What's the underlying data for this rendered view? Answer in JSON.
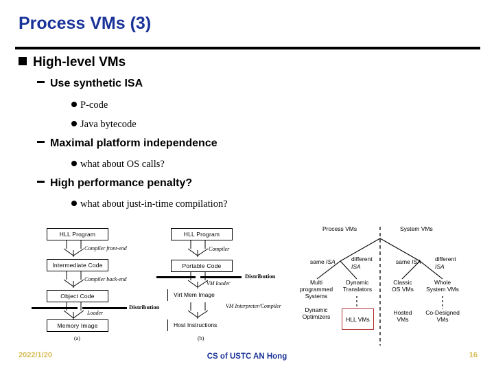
{
  "slide": {
    "title": "Process VMs (3)",
    "title_color": "#1a3399",
    "accent_rule_color": "#000000"
  },
  "outline": [
    {
      "level": 1,
      "text": "High-level VMs"
    },
    {
      "level": 2,
      "text": "Use synthetic ISA"
    },
    {
      "level": 3,
      "text": "P-code"
    },
    {
      "level": 3,
      "text": "Java bytecode"
    },
    {
      "level": 2,
      "text": "Maximal platform independence"
    },
    {
      "level": 3,
      "text": "what about OS calls?"
    },
    {
      "level": 2,
      "text": "High performance penalty?"
    },
    {
      "level": 3,
      "text": "what about just-in-time compilation?"
    }
  ],
  "diagram_a": {
    "caption": "(a)",
    "boxes": [
      "HLL Program",
      "Intermediate Code",
      "Object Code",
      "Memory Image"
    ],
    "edge_labels": [
      "Compiler front-end",
      "Compiler back-end",
      "Loader"
    ],
    "distribution_label": "Distribution"
  },
  "diagram_b": {
    "caption": "(b)",
    "boxes": [
      "HLL Program",
      "Portable Code"
    ],
    "bars": [
      "Virt Mem Image",
      "Host Instructions"
    ],
    "edge_labels": [
      "Compiler",
      "VM loader",
      "VM Interpreter/Compiler"
    ],
    "distribution_label": "Distribution"
  },
  "taxonomy": {
    "headings": [
      "Process VMs",
      "System VMs"
    ],
    "edge_labels": [
      {
        "plain": "same ",
        "italic": "ISA"
      },
      {
        "plain": "different ",
        "italic": "ISA"
      },
      {
        "plain": "same ",
        "italic": "ISA"
      },
      {
        "plain": "different ",
        "italic": "ISA"
      }
    ],
    "nodes": [
      {
        "lines": [
          "Multi",
          "programmed",
          "Systems"
        ]
      },
      {
        "lines": [
          "Dynamic",
          "Translators"
        ]
      },
      {
        "lines": [
          "Classic",
          "OS VMs"
        ]
      },
      {
        "lines": [
          "Whole",
          "System VMs"
        ]
      }
    ],
    "sub_nodes": [
      {
        "lines": [
          "Dynamic",
          "Optimizers"
        ]
      },
      {
        "lines": [
          "HLL VMs"
        ],
        "highlight": true,
        "highlight_color": "#b03030"
      },
      {
        "lines": [
          "Hosted",
          "VMs"
        ]
      },
      {
        "lines": [
          "Co-Designed",
          "VMs"
        ]
      }
    ]
  },
  "footer": {
    "date": "2022/1/20",
    "center": "CS of USTC AN Hong",
    "page": "16",
    "date_color": "#d6bb52",
    "center_color": "#1a3399"
  }
}
